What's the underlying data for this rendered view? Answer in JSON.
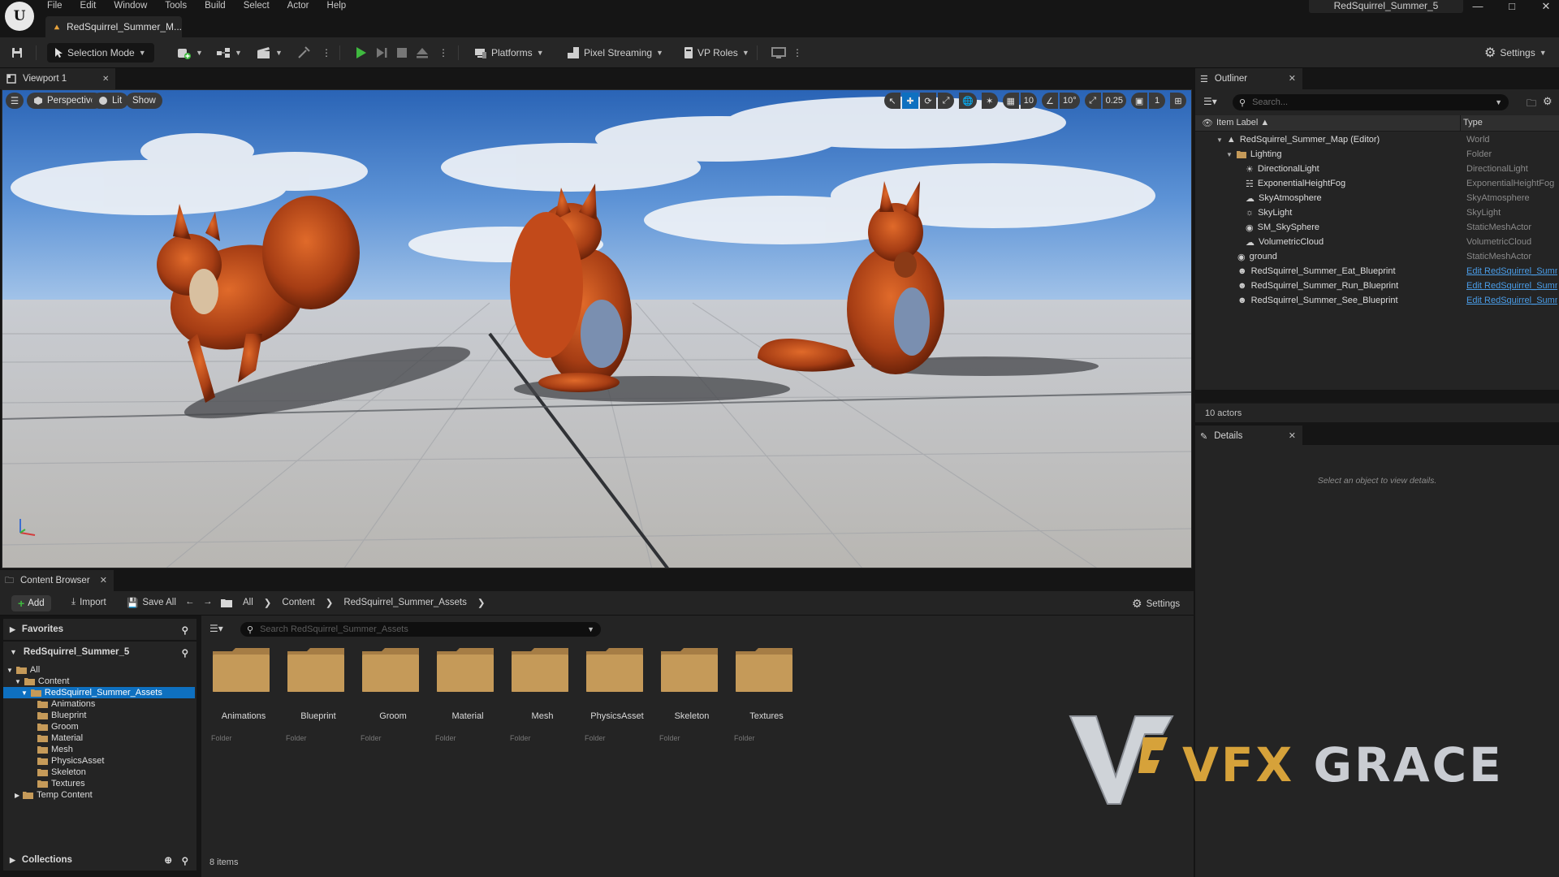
{
  "menu": [
    "File",
    "Edit",
    "Window",
    "Tools",
    "Build",
    "Select",
    "Actor",
    "Help"
  ],
  "level_tab": "RedSquirrel_Summer_M...",
  "window_title": "RedSquirrel_Summer_5",
  "toolbar": {
    "selection_mode": "Selection Mode",
    "platforms": "Platforms",
    "pixel_streaming": "Pixel Streaming",
    "vp_roles": "VP Roles",
    "settings": "Settings"
  },
  "viewport": {
    "tab": "Viewport 1",
    "perspective": "Perspective",
    "lit": "Lit",
    "show": "Show",
    "grid_snap": "10",
    "rotation_snap": "10°",
    "scale_snap": "0.25",
    "camera_speed": "1"
  },
  "outliner": {
    "tab": "Outliner",
    "search_placeholder": "Search...",
    "col_label": "Item Label",
    "col_type": "Type",
    "rows": [
      {
        "label": "RedSquirrel_Summer_Map (Editor)",
        "type": "World"
      },
      {
        "label": "Lighting",
        "type": "Folder"
      },
      {
        "label": "DirectionalLight",
        "type": "DirectionalLight"
      },
      {
        "label": "ExponentialHeightFog",
        "type": "ExponentialHeightFog"
      },
      {
        "label": "SkyAtmosphere",
        "type": "SkyAtmosphere"
      },
      {
        "label": "SkyLight",
        "type": "SkyLight"
      },
      {
        "label": "SM_SkySphere",
        "type": "StaticMeshActor"
      },
      {
        "label": "VolumetricCloud",
        "type": "VolumetricCloud"
      },
      {
        "label": "ground",
        "type": "StaticMeshActor"
      },
      {
        "label": "RedSquirrel_Summer_Eat_Blueprint",
        "type": "Edit RedSquirrel_Summ"
      },
      {
        "label": "RedSquirrel_Summer_Run_Blueprint",
        "type": "Edit RedSquirrel_Summ"
      },
      {
        "label": "RedSquirrel_Summer_See_Blueprint",
        "type": "Edit RedSquirrel_Summ"
      }
    ],
    "actor_count": "10 actors"
  },
  "details": {
    "tab": "Details",
    "empty_text": "Select an object to view details."
  },
  "content_browser": {
    "tab": "Content Browser",
    "add": "Add",
    "import": "Import",
    "save_all": "Save All",
    "breadcrumb": [
      "All",
      "Content",
      "RedSquirrel_Summer_Assets"
    ],
    "settings": "Settings",
    "favorites": "Favorites",
    "project": "RedSquirrel_Summer_5",
    "collections": "Collections",
    "search_placeholder": "Search RedSquirrel_Summer_Assets",
    "tree": [
      "All",
      "Content",
      "RedSquirrel_Summer_Assets",
      "Animations",
      "Blueprint",
      "Groom",
      "Material",
      "Mesh",
      "PhysicsAsset",
      "Skeleton",
      "Textures",
      "Temp Content"
    ],
    "folders": [
      "Animations",
      "Blueprint",
      "Groom",
      "Material",
      "Mesh",
      "PhysicsAsset",
      "Skeleton",
      "Textures"
    ],
    "folder_type": "Folder",
    "items_count": "8 items"
  },
  "watermark": {
    "vfx": "VFX",
    "grace": "GRACE"
  },
  "colors": {
    "accent": "#0e70c0",
    "panel": "#242424",
    "background": "#151515",
    "play": "#3fb93f",
    "folder": "#c59a59"
  }
}
